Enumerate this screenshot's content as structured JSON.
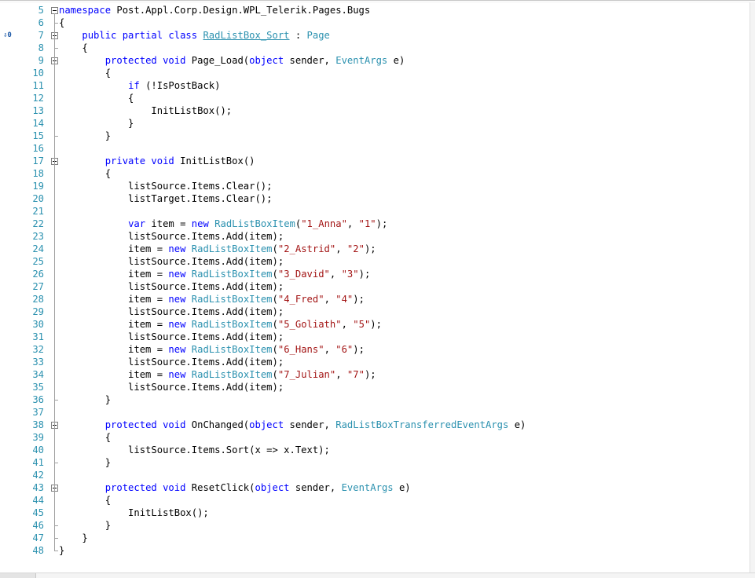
{
  "editor": {
    "margin_glyph_line": 7,
    "margin_glyph_text": "⇩0",
    "lines": [
      {
        "n": "5",
        "code": [
          [
            "k",
            "namespace"
          ],
          [
            "p",
            " Post.Appl.Corp.Design.WPL_Telerik.Pages.Bugs"
          ]
        ]
      },
      {
        "n": "6",
        "code": [
          [
            "p",
            "{"
          ]
        ]
      },
      {
        "n": "7",
        "code": [
          [
            "p",
            "    "
          ],
          [
            "k",
            "public partial class"
          ],
          [
            "p",
            " "
          ],
          [
            "tu",
            "RadListBox_Sort"
          ],
          [
            "p",
            " : "
          ],
          [
            "t",
            "Page"
          ]
        ]
      },
      {
        "n": "8",
        "code": [
          [
            "p",
            "    {"
          ]
        ]
      },
      {
        "n": "9",
        "code": [
          [
            "p",
            "        "
          ],
          [
            "k",
            "protected void"
          ],
          [
            "p",
            " Page_Load("
          ],
          [
            "k",
            "object"
          ],
          [
            "p",
            " sender, "
          ],
          [
            "t",
            "EventArgs"
          ],
          [
            "p",
            " e)"
          ]
        ]
      },
      {
        "n": "10",
        "code": [
          [
            "p",
            "        {"
          ]
        ]
      },
      {
        "n": "11",
        "code": [
          [
            "p",
            "            "
          ],
          [
            "k",
            "if"
          ],
          [
            "p",
            " (!IsPostBack)"
          ]
        ]
      },
      {
        "n": "12",
        "code": [
          [
            "p",
            "            {"
          ]
        ]
      },
      {
        "n": "13",
        "code": [
          [
            "p",
            "                InitListBox();"
          ]
        ]
      },
      {
        "n": "14",
        "code": [
          [
            "p",
            "            }"
          ]
        ]
      },
      {
        "n": "15",
        "code": [
          [
            "p",
            "        }"
          ]
        ]
      },
      {
        "n": "16",
        "code": [
          [
            "p",
            ""
          ]
        ]
      },
      {
        "n": "17",
        "code": [
          [
            "p",
            "        "
          ],
          [
            "k",
            "private void"
          ],
          [
            "p",
            " InitListBox()"
          ]
        ]
      },
      {
        "n": "18",
        "code": [
          [
            "p",
            "        {"
          ]
        ]
      },
      {
        "n": "19",
        "code": [
          [
            "p",
            "            listSource.Items.Clear();"
          ]
        ]
      },
      {
        "n": "20",
        "code": [
          [
            "p",
            "            listTarget.Items.Clear();"
          ]
        ]
      },
      {
        "n": "21",
        "code": [
          [
            "p",
            ""
          ]
        ]
      },
      {
        "n": "22",
        "code": [
          [
            "p",
            "            "
          ],
          [
            "k",
            "var"
          ],
          [
            "p",
            " item = "
          ],
          [
            "k",
            "new"
          ],
          [
            "p",
            " "
          ],
          [
            "t",
            "RadListBoxItem"
          ],
          [
            "p",
            "("
          ],
          [
            "s",
            "\"1_Anna\""
          ],
          [
            "p",
            ", "
          ],
          [
            "s",
            "\"1\""
          ],
          [
            "p",
            ");"
          ]
        ]
      },
      {
        "n": "23",
        "code": [
          [
            "p",
            "            listSource.Items.Add(item);"
          ]
        ]
      },
      {
        "n": "24",
        "code": [
          [
            "p",
            "            item = "
          ],
          [
            "k",
            "new"
          ],
          [
            "p",
            " "
          ],
          [
            "t",
            "RadListBoxItem"
          ],
          [
            "p",
            "("
          ],
          [
            "s",
            "\"2_Astrid\""
          ],
          [
            "p",
            ", "
          ],
          [
            "s",
            "\"2\""
          ],
          [
            "p",
            ");"
          ]
        ]
      },
      {
        "n": "25",
        "code": [
          [
            "p",
            "            listSource.Items.Add(item);"
          ]
        ]
      },
      {
        "n": "26",
        "code": [
          [
            "p",
            "            item = "
          ],
          [
            "k",
            "new"
          ],
          [
            "p",
            " "
          ],
          [
            "t",
            "RadListBoxItem"
          ],
          [
            "p",
            "("
          ],
          [
            "s",
            "\"3_David\""
          ],
          [
            "p",
            ", "
          ],
          [
            "s",
            "\"3\""
          ],
          [
            "p",
            ");"
          ]
        ]
      },
      {
        "n": "27",
        "code": [
          [
            "p",
            "            listSource.Items.Add(item);"
          ]
        ]
      },
      {
        "n": "28",
        "code": [
          [
            "p",
            "            item = "
          ],
          [
            "k",
            "new"
          ],
          [
            "p",
            " "
          ],
          [
            "t",
            "RadListBoxItem"
          ],
          [
            "p",
            "("
          ],
          [
            "s",
            "\"4_Fred\""
          ],
          [
            "p",
            ", "
          ],
          [
            "s",
            "\"4\""
          ],
          [
            "p",
            ");"
          ]
        ]
      },
      {
        "n": "29",
        "code": [
          [
            "p",
            "            listSource.Items.Add(item);"
          ]
        ]
      },
      {
        "n": "30",
        "code": [
          [
            "p",
            "            item = "
          ],
          [
            "k",
            "new"
          ],
          [
            "p",
            " "
          ],
          [
            "t",
            "RadListBoxItem"
          ],
          [
            "p",
            "("
          ],
          [
            "s",
            "\"5_Goliath\""
          ],
          [
            "p",
            ", "
          ],
          [
            "s",
            "\"5\""
          ],
          [
            "p",
            ");"
          ]
        ]
      },
      {
        "n": "31",
        "code": [
          [
            "p",
            "            listSource.Items.Add(item);"
          ]
        ]
      },
      {
        "n": "32",
        "code": [
          [
            "p",
            "            item = "
          ],
          [
            "k",
            "new"
          ],
          [
            "p",
            " "
          ],
          [
            "t",
            "RadListBoxItem"
          ],
          [
            "p",
            "("
          ],
          [
            "s",
            "\"6_Hans\""
          ],
          [
            "p",
            ", "
          ],
          [
            "s",
            "\"6\""
          ],
          [
            "p",
            ");"
          ]
        ]
      },
      {
        "n": "33",
        "code": [
          [
            "p",
            "            listSource.Items.Add(item);"
          ]
        ]
      },
      {
        "n": "34",
        "code": [
          [
            "p",
            "            item = "
          ],
          [
            "k",
            "new"
          ],
          [
            "p",
            " "
          ],
          [
            "t",
            "RadListBoxItem"
          ],
          [
            "p",
            "("
          ],
          [
            "s",
            "\"7_Julian\""
          ],
          [
            "p",
            ", "
          ],
          [
            "s",
            "\"7\""
          ],
          [
            "p",
            ");"
          ]
        ]
      },
      {
        "n": "35",
        "code": [
          [
            "p",
            "            listSource.Items.Add(item);"
          ]
        ]
      },
      {
        "n": "36",
        "code": [
          [
            "p",
            "        }"
          ]
        ]
      },
      {
        "n": "37",
        "code": [
          [
            "p",
            ""
          ]
        ]
      },
      {
        "n": "38",
        "code": [
          [
            "p",
            "        "
          ],
          [
            "k",
            "protected void"
          ],
          [
            "p",
            " OnChanged("
          ],
          [
            "k",
            "object"
          ],
          [
            "p",
            " sender, "
          ],
          [
            "t",
            "RadListBoxTransferredEventArgs"
          ],
          [
            "p",
            " e)"
          ]
        ]
      },
      {
        "n": "39",
        "code": [
          [
            "p",
            "        {"
          ]
        ]
      },
      {
        "n": "40",
        "code": [
          [
            "p",
            "            listSource.Items.Sort(x => x.Text);"
          ]
        ]
      },
      {
        "n": "41",
        "code": [
          [
            "p",
            "        }"
          ]
        ]
      },
      {
        "n": "42",
        "code": [
          [
            "p",
            ""
          ]
        ]
      },
      {
        "n": "43",
        "code": [
          [
            "p",
            "        "
          ],
          [
            "k",
            "protected void"
          ],
          [
            "p",
            " ResetClick("
          ],
          [
            "k",
            "object"
          ],
          [
            "p",
            " sender, "
          ],
          [
            "t",
            "EventArgs"
          ],
          [
            "p",
            " e)"
          ]
        ]
      },
      {
        "n": "44",
        "code": [
          [
            "p",
            "        {"
          ]
        ]
      },
      {
        "n": "45",
        "code": [
          [
            "p",
            "            InitListBox();"
          ]
        ]
      },
      {
        "n": "46",
        "code": [
          [
            "p",
            "        }"
          ]
        ]
      },
      {
        "n": "47",
        "code": [
          [
            "p",
            "    }"
          ]
        ]
      },
      {
        "n": "48",
        "code": [
          [
            "p",
            "}"
          ]
        ]
      }
    ],
    "fold_lines": [
      5,
      7,
      9,
      17,
      38,
      43
    ]
  }
}
